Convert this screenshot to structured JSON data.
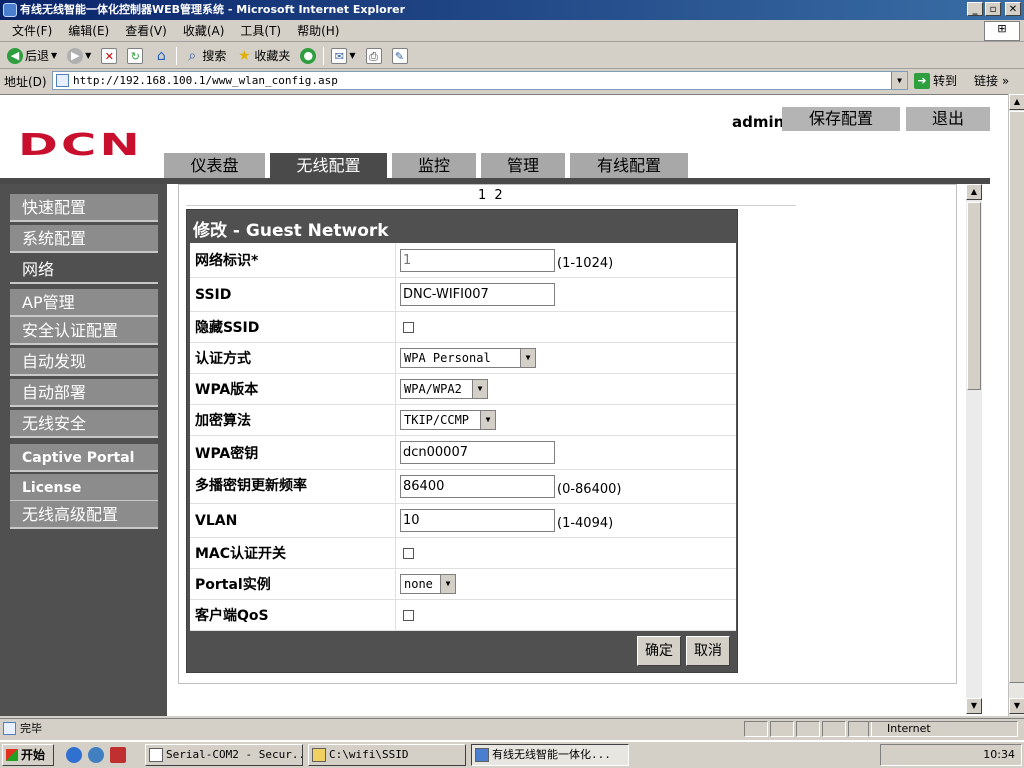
{
  "window": {
    "title": "有线无线智能一体化控制器WEB管理系统 - Microsoft Internet Explorer"
  },
  "menubar": {
    "items": [
      "文件(F)",
      "编辑(E)",
      "查看(V)",
      "收藏(A)",
      "工具(T)",
      "帮助(H)"
    ]
  },
  "toolbar": {
    "back": "后退",
    "search": "搜索",
    "favorites": "收藏夹"
  },
  "addressbar": {
    "label": "地址(D)",
    "url": "http://192.168.100.1/www_wlan_config.asp",
    "go": "转到",
    "links": "链接 »"
  },
  "header": {
    "logo": "DCN",
    "user": "admin",
    "save_config": "保存配置",
    "logout": "退出",
    "tabs": [
      "仪表盘",
      "无线配置",
      "监控",
      "管理",
      "有线配置"
    ],
    "active_tab": "无线配置"
  },
  "sidebar": {
    "items": [
      "快速配置",
      "系统配置",
      "网络",
      "AP管理",
      "安全认证配置",
      "自动发现",
      "自动部署",
      "无线安全",
      "Captive Portal",
      "License",
      "无线高级配置"
    ],
    "selected": "网络"
  },
  "pagination": "1 2",
  "form": {
    "title": "修改 - Guest Network",
    "rows": {
      "network_id": {
        "label": "网络标识*",
        "value": "1",
        "range": "(1-1024)"
      },
      "ssid": {
        "label": "SSID",
        "value": "DNC-WIFI007"
      },
      "hide_ssid": {
        "label": "隐藏SSID",
        "checked": false
      },
      "auth_method": {
        "label": "认证方式",
        "value": "WPA Personal"
      },
      "wpa_version": {
        "label": "WPA版本",
        "value": "WPA/WPA2"
      },
      "encryption": {
        "label": "加密算法",
        "value": "TKIP/CCMP"
      },
      "wpa_key": {
        "label": "WPA密钥",
        "value": "dcn00007"
      },
      "multicast_rekey": {
        "label": "多播密钥更新频率",
        "value": "86400",
        "range": "(0-86400)"
      },
      "vlan": {
        "label": "VLAN",
        "value": "10",
        "range": "(1-4094)"
      },
      "mac_auth": {
        "label": "MAC认证开关",
        "checked": false
      },
      "portal_instance": {
        "label": "Portal实例",
        "value": "none"
      },
      "client_qos": {
        "label": "客户端QoS",
        "checked": false
      }
    },
    "ok": "确定",
    "cancel": "取消"
  },
  "statusbar": {
    "text": "完毕",
    "zone": "Internet"
  },
  "taskbar": {
    "start": "开始",
    "tasks": [
      "Serial-COM2 - Secur...",
      "C:\\wifi\\SSID",
      "有线无线智能一体化..."
    ],
    "clock": "10:34"
  }
}
